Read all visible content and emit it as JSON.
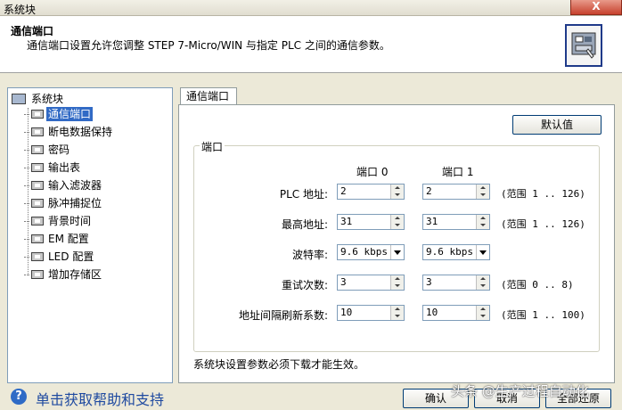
{
  "window": {
    "title": "系统块",
    "close_label": "X"
  },
  "header": {
    "title": "通信端口",
    "description": "通信端口设置允许您调整 STEP 7-Micro/WIN 与指定 PLC 之间的通信参数。",
    "icon": "plc-comm-icon"
  },
  "tree": {
    "root_label": "系统块",
    "items": [
      {
        "label": "通信端口",
        "selected": true
      },
      {
        "label": "断电数据保持"
      },
      {
        "label": "密码"
      },
      {
        "label": "输出表"
      },
      {
        "label": "输入滤波器"
      },
      {
        "label": "脉冲捕捉位"
      },
      {
        "label": "背景时间"
      },
      {
        "label": "EM 配置"
      },
      {
        "label": "LED 配置"
      },
      {
        "label": "增加存储区"
      }
    ]
  },
  "tab": {
    "label": "通信端口"
  },
  "default_button": "默认值",
  "group": {
    "title": "端口",
    "col_port0": "端口 0",
    "col_port1": "端口 1",
    "rows": [
      {
        "label": "PLC 地址:",
        "port0": "2",
        "port1": "2",
        "range": "(范围 1 .. 126)"
      },
      {
        "label": "最高地址:",
        "port0": "31",
        "port1": "31",
        "range": "(范围 1 .. 126)"
      },
      {
        "label": "波特率:",
        "port0": "9.6 kbps",
        "port1": "9.6 kbps",
        "range": ""
      },
      {
        "label": "重试次数:",
        "port0": "3",
        "port1": "3",
        "range": "(范围 0 .. 8)"
      },
      {
        "label": "地址间隔刷新系数:",
        "port0": "10",
        "port1": "10",
        "range": "(范围 1 .. 100)"
      }
    ]
  },
  "note": "系统块设置参数必须下载才能生效。",
  "help": {
    "icon": "help-icon",
    "label": "单击获取帮助和支持"
  },
  "buttons": {
    "ok": "确认",
    "cancel": "取消",
    "all": "全部还原"
  },
  "watermark": "头条 @生产过程自动化"
}
